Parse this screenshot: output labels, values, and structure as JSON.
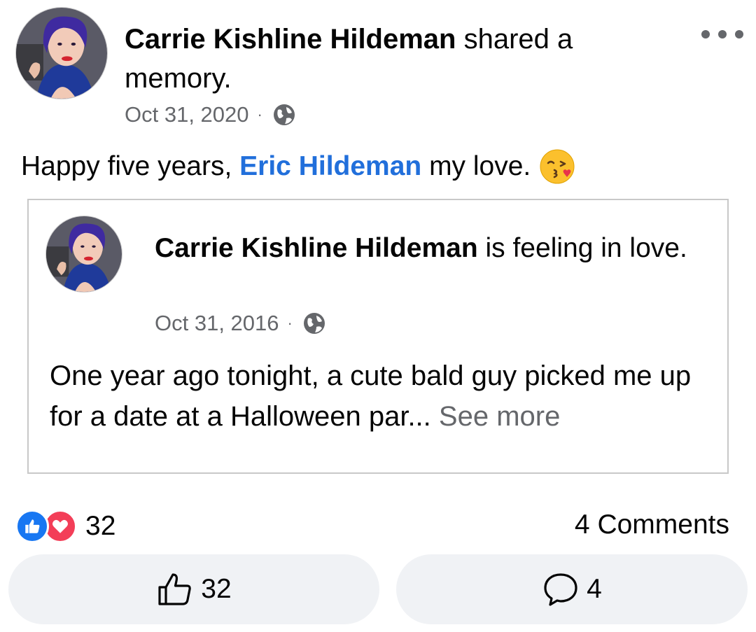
{
  "header": {
    "author": "Carrie Kishline Hildeman",
    "action": " shared a memory.",
    "date": "Oct 31, 2020",
    "separator": "·",
    "privacy_icon": "globe-icon",
    "more_icon": "more-options-icon"
  },
  "post": {
    "text_before": "Happy five years, ",
    "mention": "Eric Hildeman",
    "text_after": " my love.",
    "emoji": "kissing-face-emoji"
  },
  "shared": {
    "author": "Carrie Kishline Hildeman",
    "action": " is feeling in love.",
    "date": "Oct 31, 2016",
    "separator": "·",
    "privacy_icon": "globe-icon",
    "body": "One year ago tonight, a cute bald guy picked me up for a date at a Halloween par...",
    "see_more": " See more"
  },
  "stats": {
    "reaction_icons": [
      "like-icon",
      "love-icon"
    ],
    "reactions_count": "32",
    "comments": "4 Comments"
  },
  "actions": {
    "like_count": "32",
    "comment_count": "4"
  },
  "colors": {
    "mention": "#216fdb",
    "muted": "#65676b",
    "like": "#1877f2",
    "love": "#f33e58",
    "button_bg": "#f0f2f5"
  }
}
